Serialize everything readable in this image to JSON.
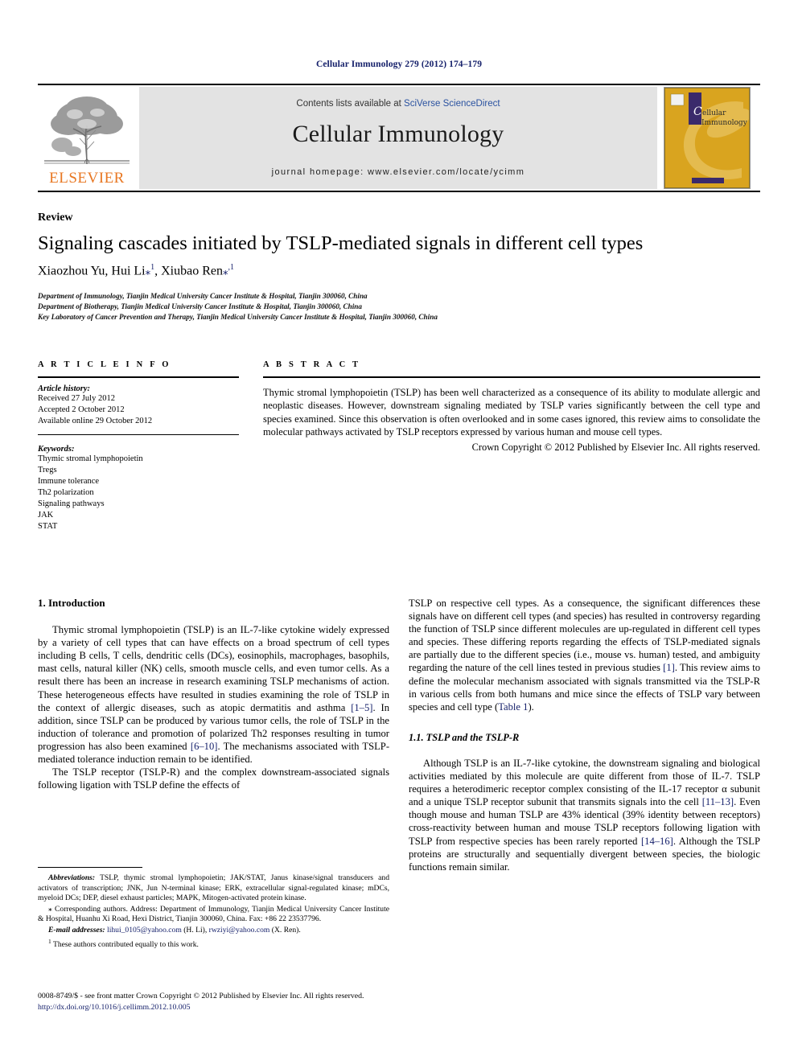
{
  "running_head": "Cellular Immunology 279 (2012) 174–179",
  "journal_header": {
    "contents_prefix": "Contents lists available at ",
    "contents_link": "SciVerse ScienceDirect",
    "journal_name": "Cellular Immunology",
    "homepage": "journal homepage: www.elsevier.com/locate/ycimm",
    "publisher_wordmark": "ELSEVIER",
    "cover_title_line1": "ellular",
    "cover_title_line2": "Immunology",
    "cover_big_letter": "C"
  },
  "article": {
    "doctype": "Review",
    "title": "Signaling cascades initiated by TSLP-mediated signals in different cell types",
    "authors_plain": "Xiaozhou Yu, Hui Li",
    "author2": "Hui Li",
    "author3": "Xiubao Ren",
    "affiliations": [
      "Department of Immunology, Tianjin Medical University Cancer Institute & Hospital, Tianjin 300060, China",
      "Department of Biotherapy, Tianjin Medical University Cancer Institute & Hospital, Tianjin 300060, China",
      "Key Laboratory of Cancer Prevention and Therapy, Tianjin Medical University Cancer Institute & Hospital, Tianjin 300060, China"
    ]
  },
  "info": {
    "heading": "A R T I C L E    I N F O",
    "history_label": "Article history:",
    "history": [
      "Received 27 July 2012",
      "Accepted 2 October 2012",
      "Available online 29 October 2012"
    ],
    "keywords_label": "Keywords:",
    "keywords": [
      "Thymic stromal lymphopoietin",
      "Tregs",
      "Immune tolerance",
      "Th2 polarization",
      "Signaling pathways",
      "JAK",
      "STAT"
    ]
  },
  "abstract": {
    "heading": "A B S T R A C T",
    "text": "Thymic stromal lymphopoietin (TSLP) has been well characterized as a consequence of its ability to modulate allergic and neoplastic diseases. However, downstream signaling mediated by TSLP varies significantly between the cell type and species examined. Since this observation is often overlooked and in some cases ignored, this review aims to consolidate the molecular pathways activated by TSLP receptors expressed by various human and mouse cell types.",
    "copyright": "Crown Copyright © 2012 Published by Elsevier Inc. All rights reserved."
  },
  "body": {
    "section1_heading": "1. Introduction",
    "left_p1_a": "Thymic stromal lymphopoietin (TSLP) is an IL-7-like cytokine widely expressed by a variety of cell types that can have effects on a broad spectrum of cell types including B cells, T cells, dendritic cells (DCs), eosinophils, macrophages, basophils, mast cells, natural killer (NK) cells, smooth muscle cells, and even tumor cells. As a result there has been an increase in research examining TSLP mechanisms of action. These heterogeneous effects have resulted in studies examining the role of TSLP in the context of allergic diseases, such as atopic dermatitis and asthma ",
    "ref_1_5": "[1–5]",
    "left_p1_b": ". In addition, since TSLP can be produced by various tumor cells, the role of TSLP in the induction of tolerance and promotion of polarized Th2 responses resulting in tumor progression has also been examined ",
    "ref_6_10": "[6–10]",
    "left_p1_c": ". The mechanisms associated with TSLP-mediated tolerance induction remain to be identified.",
    "left_p2": "The TSLP receptor (TSLP-R) and the complex downstream-associated signals following ligation with TSLP define the effects of",
    "right_p1_a": "TSLP on respective cell types. As a consequence, the significant differences these signals have on different cell types (and species) has resulted in controversy regarding the function of TSLP since different molecules are up-regulated in different cell types and species. These differing reports regarding the effects of TSLP-mediated signals are partially due to the different species (i.e., mouse vs. human) tested, and ambiguity regarding the nature of the cell lines tested in previous studies ",
    "ref_1": "[1]",
    "right_p1_b": ". This review aims to define the molecular mechanism associated with signals transmitted via the TSLP-R in various cells from both humans and mice since the effects of TSLP vary between species and cell type (",
    "ref_table1": "Table 1",
    "right_p1_c": ").",
    "section11_heading": "1.1. TSLP and the TSLP-R",
    "right_p2_a": "Although TSLP is an IL-7-like cytokine, the downstream signaling and biological activities mediated by this molecule are quite different from those of IL-7. TSLP requires a heterodimeric receptor complex consisting of the IL-17 receptor α subunit and a unique TSLP receptor subunit that transmits signals into the cell ",
    "ref_11_13": "[11–13]",
    "right_p2_b": ". Even though mouse and human TSLP are 43% identical (39% identity between receptors) cross-reactivity between human and mouse TSLP receptors following ligation with TSLP from respective species has been rarely reported ",
    "ref_14_16": "[14–16]",
    "right_p2_c": ". Although the TSLP proteins are structurally and sequentially divergent between species, the biologic functions remain similar."
  },
  "footnotes": {
    "abbrev_label": "Abbreviations:",
    "abbrev_text": " TSLP, thymic stromal lymphopoietin; JAK/STAT, Janus kinase/signal transducers and activators of transcription; JNK, Jun N-terminal kinase; ERK, extracellular signal-regulated kinase; mDCs, myeloid DCs; DEP, diesel exhaust particles; MAPK, Mitogen-activated protein kinase.",
    "corresponding_marker": "⁎",
    "corresponding_text": " Corresponding authors. Address: Department of Immunology, Tianjin Medical University Cancer Institute & Hospital, Huanhu Xi Road, Hexi District, Tianjin 300060, China. Fax: +86 22 23537796.",
    "email_label": "E-mail addresses:",
    "email1": "lihui_0105@yahoo.com",
    "email1_owner": " (H. Li), ",
    "email2": "rwziyi@yahoo.com",
    "email2_owner": " (X. Ren).",
    "equal_marker": "1",
    "equal_text": " These authors contributed equally to this work."
  },
  "page_footer": {
    "issn_line": "0008-8749/$ - see front matter Crown Copyright © 2012 Published by Elsevier Inc. All rights reserved.",
    "doi": "http://dx.doi.org/10.1016/j.cellimm.2012.10.005"
  },
  "colors": {
    "link_blue": "#16216b",
    "elsevier_orange": "#E87722",
    "header_grey": "#e3e3e3",
    "cover_gold": "#d8a823"
  }
}
